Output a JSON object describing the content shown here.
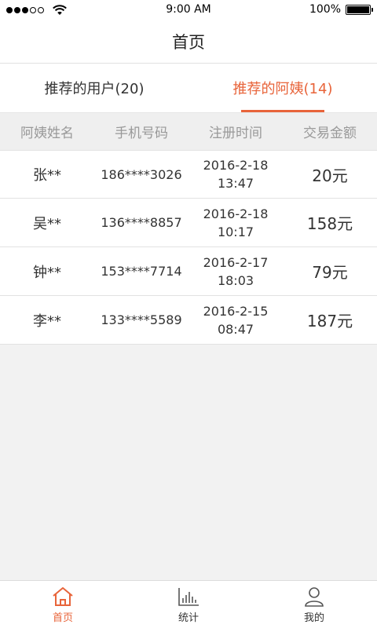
{
  "status_bar": {
    "time": "9:00 AM",
    "battery": "100%"
  },
  "nav": {
    "title": "首页"
  },
  "tabs": [
    {
      "label": "推荐的用户(20)",
      "active": false
    },
    {
      "label": "推荐的阿姨(14)",
      "active": true
    }
  ],
  "table": {
    "columns": [
      "阿姨姓名",
      "手机号码",
      "注册时间",
      "交易金额"
    ],
    "rows": [
      {
        "name": "张**",
        "phone": "186****3026",
        "date": "2016-2-18",
        "time": "13:47",
        "amount": "20元"
      },
      {
        "name": "吴**",
        "phone": "136****8857",
        "date": "2016-2-18",
        "time": "10:17",
        "amount": "158元"
      },
      {
        "name": "钟**",
        "phone": "153****7714",
        "date": "2016-2-17",
        "time": "18:03",
        "amount": "79元"
      },
      {
        "name": "李**",
        "phone": "133****5589",
        "date": "2016-2-15",
        "time": "08:47",
        "amount": "187元"
      }
    ]
  },
  "tabbar": [
    {
      "label": "首页",
      "icon": "home-icon",
      "active": true
    },
    {
      "label": "统计",
      "icon": "chart-icon",
      "active": false
    },
    {
      "label": "我的",
      "icon": "person-icon",
      "active": false
    }
  ],
  "colors": {
    "accent": "#e8643a",
    "header_bg": "#efefef",
    "page_bg": "#f2f2f2"
  }
}
